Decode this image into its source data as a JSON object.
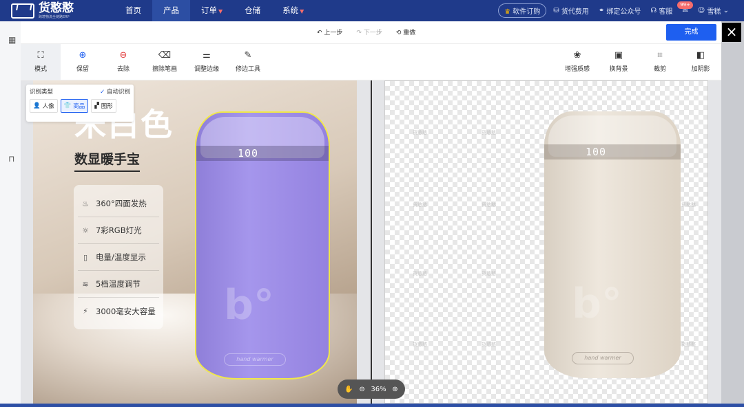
{
  "brand": {
    "name": "货憨憨",
    "tagline": "跨境物流全链路ERP"
  },
  "nav": {
    "items": [
      {
        "label": "首页",
        "active": false,
        "dropdown": false
      },
      {
        "label": "产品",
        "active": true,
        "dropdown": false
      },
      {
        "label": "订单",
        "active": false,
        "dropdown": true
      },
      {
        "label": "仓储",
        "active": false,
        "dropdown": false
      },
      {
        "label": "系统",
        "active": false,
        "dropdown": true
      }
    ],
    "right": {
      "buy": "软件订购",
      "fees": "货代费用",
      "bind": "绑定公众号",
      "service": "客服",
      "msg_badge": "99+",
      "user": "雪糕"
    }
  },
  "editor": {
    "undo": "上一步",
    "redo": "下一步",
    "reset": "重做",
    "done": "完成",
    "close": "×",
    "tools_left": [
      {
        "label": "模式",
        "icon": "mode-icon"
      },
      {
        "label": "保留",
        "icon": "plus-circle-icon"
      },
      {
        "label": "去除",
        "icon": "minus-circle-icon"
      },
      {
        "label": "擦除笔画",
        "icon": "eraser-icon"
      },
      {
        "label": "调整边缘",
        "icon": "sliders-icon"
      },
      {
        "label": "修边工具",
        "icon": "brush-icon"
      }
    ],
    "tools_right": [
      {
        "label": "增强质感",
        "icon": "enhance-icon"
      },
      {
        "label": "换背景",
        "icon": "background-icon"
      },
      {
        "label": "裁剪",
        "icon": "crop-icon"
      },
      {
        "label": "加阴影",
        "icon": "shadow-icon"
      }
    ],
    "identify": {
      "title": "识别类型",
      "auto": "自动识别",
      "types": [
        {
          "label": "人像",
          "selected": false
        },
        {
          "label": "商品",
          "selected": true
        },
        {
          "label": "图形",
          "selected": false
        }
      ]
    },
    "zoom": "36%"
  },
  "image": {
    "title": "米白色",
    "subtitle": "数显暖手宝",
    "features": [
      {
        "text": "360°四面发热",
        "icon": "heat-icon"
      },
      {
        "text": "7彩RGB灯光",
        "icon": "bulb-icon"
      },
      {
        "text": "电量/温度显示",
        "icon": "display-icon"
      },
      {
        "text": "5档温度调节",
        "icon": "temp-icon"
      },
      {
        "text": "3000毫安大容量",
        "icon": "battery-icon"
      }
    ],
    "device_display": "100",
    "device_logo": "b°",
    "device_text": "hand warmer",
    "watermark": "货憨憨"
  }
}
